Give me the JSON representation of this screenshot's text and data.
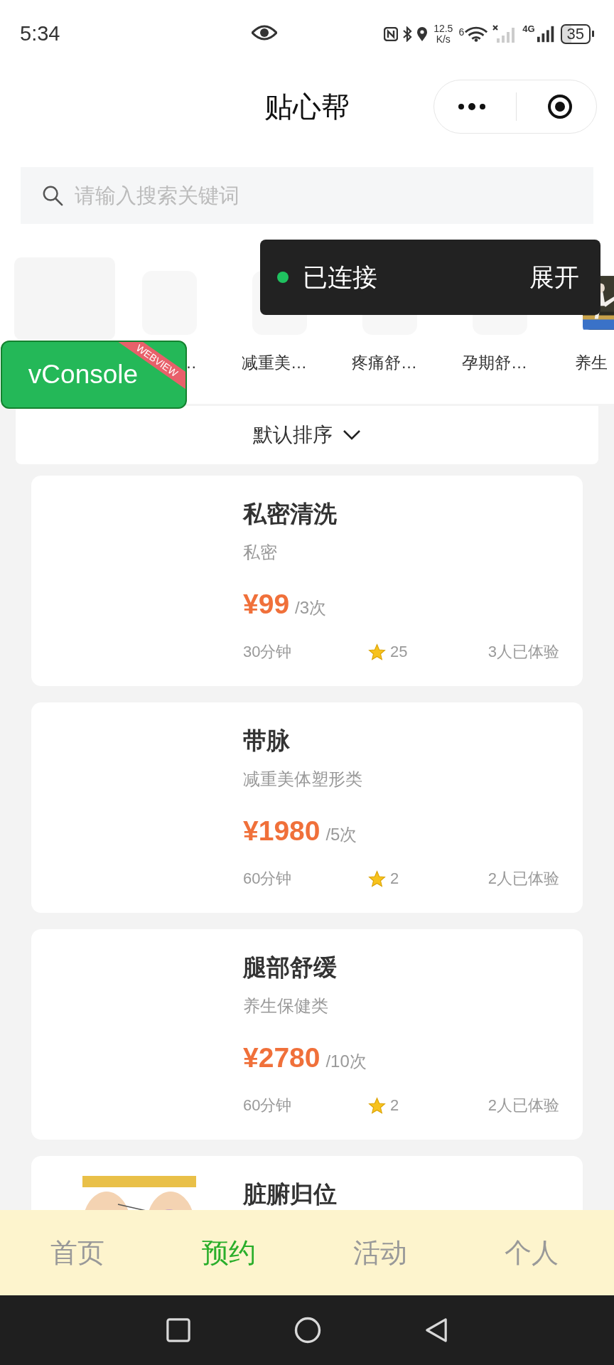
{
  "status_bar": {
    "time": "5:34",
    "net_speed": "12.5",
    "net_speed_unit": "K/s",
    "wifi_badge": "6",
    "cell_type": "4G",
    "battery": "35"
  },
  "header": {
    "title": "贴心帮"
  },
  "search": {
    "placeholder": "请输入搜索关键词"
  },
  "categories": [
    {
      "selected": true,
      "kind": "blank"
    },
    {
      "label": "…",
      "selected": false,
      "kind": "blank"
    },
    {
      "label": "减重美…",
      "selected": false,
      "kind": "blank"
    },
    {
      "label": "疼痛舒…",
      "selected": false,
      "kind": "blank"
    },
    {
      "label": "孕期舒…",
      "selected": false,
      "kind": "blank"
    },
    {
      "label": "养生",
      "selected": false,
      "kind": "picture"
    }
  ],
  "toast": {
    "status": "已连接",
    "action": "展开",
    "connected": true
  },
  "debug_button": {
    "label": "vConsole",
    "ribbon": "WEBVIEW"
  },
  "sort": {
    "label": "默认排序"
  },
  "services": [
    {
      "kind": "blank",
      "title": "私密清洗",
      "category": "私密",
      "price": "¥99",
      "unit": "/3次",
      "duration": "30分钟",
      "rating": "25",
      "experienced": "3人已体验"
    },
    {
      "kind": "blank",
      "title": "带脉",
      "category": "减重美体塑形类",
      "price": "¥1980",
      "unit": "/5次",
      "duration": "60分钟",
      "rating": "2",
      "experienced": "2人已体验"
    },
    {
      "kind": "blank",
      "title": "腿部舒缓",
      "category": "养生保健类",
      "price": "¥2780",
      "unit": "/10次",
      "duration": "60分钟",
      "rating": "2",
      "experienced": "2人已体验"
    },
    {
      "kind": "picture",
      "title": "脏腑归位"
    }
  ],
  "tabs": [
    {
      "label": "首页",
      "selected": false
    },
    {
      "label": "预约",
      "selected": true
    },
    {
      "label": "活动",
      "selected": false
    },
    {
      "label": "个人",
      "selected": false
    }
  ]
}
